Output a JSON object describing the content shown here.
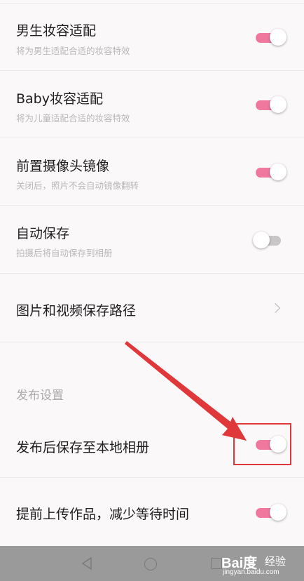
{
  "settings": [
    {
      "title": "男生妆容适配",
      "subtitle": "将为男生适配合适的妆容特效",
      "toggle": "on"
    },
    {
      "title": "Baby妆容适配",
      "subtitle": "将为儿童适配合适的妆容特效",
      "toggle": "on"
    },
    {
      "title": "前置摄像头镜像",
      "subtitle": "关闭后，照片不会自动镜像翻转",
      "toggle": "on"
    },
    {
      "title": "自动保存",
      "subtitle": "拍摄后将自动保存到相册",
      "toggle": "off"
    },
    {
      "title": "图片和视频保存路径"
    }
  ],
  "publish_section": {
    "header": "发布设置",
    "items": [
      {
        "title": "发布后保存至本地相册",
        "toggle": "on"
      },
      {
        "title": "提前上传作品，减少等待时间",
        "toggle": "on"
      }
    ]
  },
  "colors": {
    "toggle_on": "#f0789f",
    "toggle_off": "#c9c6c8",
    "annotation": "#e0383a",
    "background": "#fbf8fa"
  },
  "navbar": {
    "icons": [
      "back-triangle-icon",
      "home-circle-icon",
      "recent-square-icon"
    ]
  },
  "watermark": {
    "logo": "Bai度",
    "text": "经验",
    "url": "jingyan.baidu.com"
  }
}
